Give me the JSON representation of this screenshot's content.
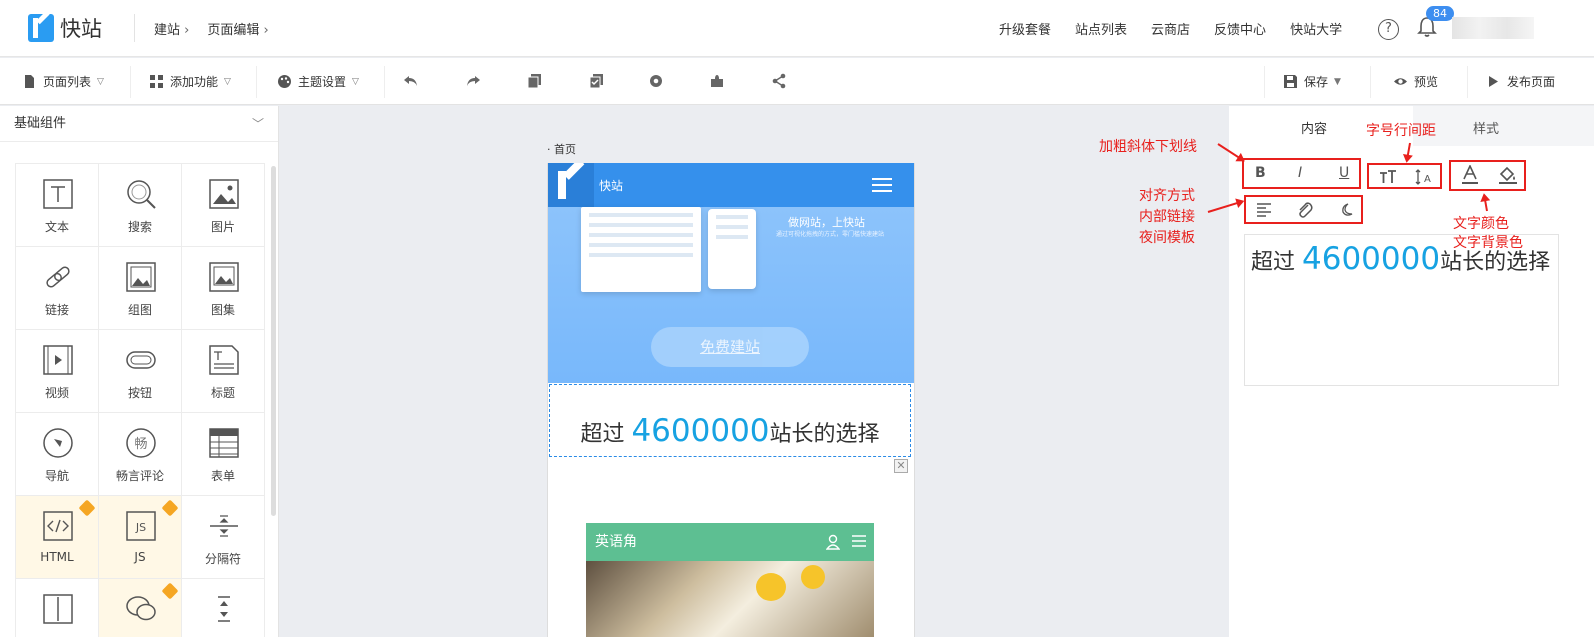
{
  "header": {
    "logo_text": "快站",
    "breadcrumbs": [
      "建站",
      "页面编辑"
    ],
    "nav": [
      "升级套餐",
      "站点列表",
      "云商店",
      "反馈中心",
      "快站大学"
    ],
    "help_glyph": "?",
    "notification_count": "84"
  },
  "toolbar": {
    "page_list": "页面列表",
    "add_feature": "添加功能",
    "theme": "主题设置",
    "save": "保存",
    "preview": "预览",
    "publish": "发布页面"
  },
  "sidebar": {
    "section_title": "基础组件",
    "components": [
      {
        "label": "文本",
        "icon": "text-icon"
      },
      {
        "label": "搜索",
        "icon": "search-icon"
      },
      {
        "label": "图片",
        "icon": "image-icon"
      },
      {
        "label": "链接",
        "icon": "link-icon"
      },
      {
        "label": "组图",
        "icon": "image-group-icon"
      },
      {
        "label": "图集",
        "icon": "gallery-icon"
      },
      {
        "label": "视频",
        "icon": "video-icon"
      },
      {
        "label": "按钮",
        "icon": "button-icon"
      },
      {
        "label": "标题",
        "icon": "title-icon"
      },
      {
        "label": "导航",
        "icon": "compass-icon"
      },
      {
        "label": "畅言评论",
        "icon": "comment-icon"
      },
      {
        "label": "表单",
        "icon": "form-icon"
      },
      {
        "label": "HTML",
        "icon": "html-icon"
      },
      {
        "label": "JS",
        "icon": "js-icon"
      },
      {
        "label": "分隔符",
        "icon": "divider-icon"
      }
    ]
  },
  "canvas": {
    "page_title": "· 首页",
    "brand": "快站",
    "banner_slogan": "做网站，上快站",
    "banner_sub": "通过可视化拖拽的方式，零门槛快速建站",
    "cta_label": "免费建站",
    "text_prefix": "超过 ",
    "text_number": "4600000",
    "text_suffix": "站长的选择",
    "close_glyph": "✕",
    "embed_title": "英语角"
  },
  "right_panel": {
    "tab_content": "内容",
    "tab_style": "样式",
    "bold": "B",
    "italic": "I",
    "underline": "U"
  },
  "annotations": {
    "bold_italic_underline": "加粗斜体下划线",
    "size_spacing": "字号行间距",
    "align": "对齐方式",
    "link": "内部链接",
    "night": "夜间模板",
    "text_color": "文字颜色",
    "text_bg": "文字背景色"
  },
  "colors": {
    "accent": "#3590ec",
    "highlight_number": "#17a2e2",
    "annotation": "#e8201d"
  }
}
